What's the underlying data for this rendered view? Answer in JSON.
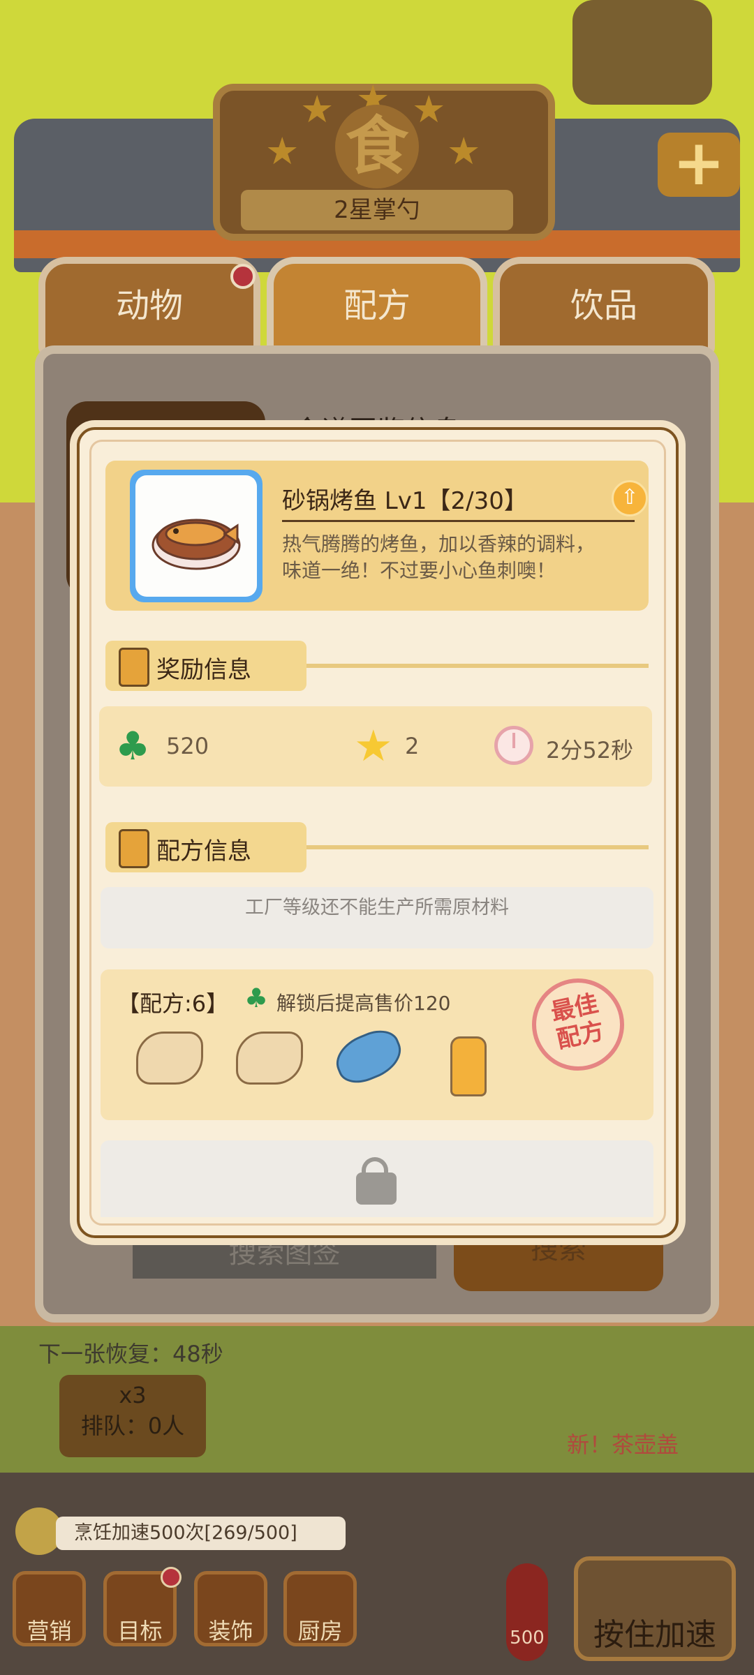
{
  "sign": {
    "glyph": "食",
    "rank": "2星掌勺"
  },
  "tabs": {
    "animal": "动物",
    "recipe": "配方",
    "drink": "饮品"
  },
  "panel": {
    "title": "食谱图鉴信息",
    "search_label": "搜索图签",
    "search_go": "搜索"
  },
  "dish": {
    "name": "砂锅烤鱼 Lv1【2/30】",
    "desc_line1": "热气腾腾的烤鱼，加以香辣的调料，",
    "desc_line2": "味道一绝！不过要小心鱼刺噢！"
  },
  "reward_section": {
    "label": "奖励信息"
  },
  "rewards": {
    "clover": "520",
    "stars": "2",
    "time": "2分52秒"
  },
  "recipe_section": {
    "label": "配方信息"
  },
  "warning": "工厂等级还不能生产所需原材料",
  "recipe": {
    "count": "【配方:6】",
    "bonus": "解锁后提高售价120",
    "stamp_line1": "最佳",
    "stamp_line2": "配方"
  },
  "hud": {
    "recover": "下一张恢复：48秒",
    "board_line1": "x3",
    "board_line2": "排队：0人",
    "new_item": "新！茶壶盖",
    "speed_text": "烹饪加速500次[269/500]",
    "btn_marketing": "营销",
    "btn_goal": "目标",
    "btn_decor": "装饰",
    "btn_kitchen": "厨房",
    "thermo_value": "500",
    "hold_btn": "按住加速"
  },
  "colors": {
    "accent": "#c38433",
    "modal_bg": "#f9eed9",
    "card_gold": "#f2d289",
    "clover": "#2e9b4d"
  }
}
